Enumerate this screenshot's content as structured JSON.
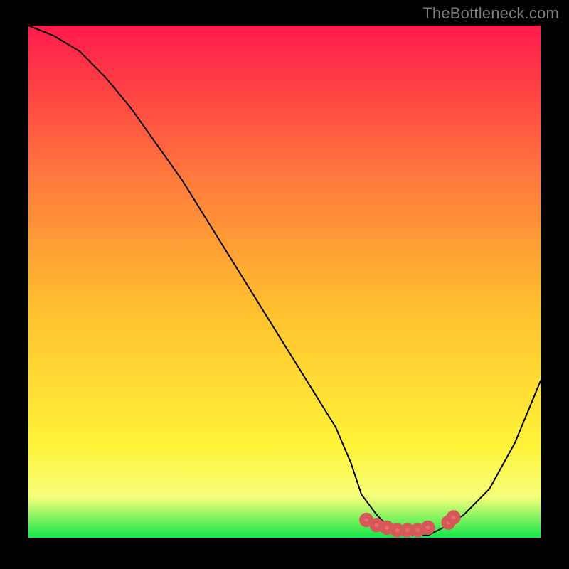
{
  "watermark": "TheBottleneck.com",
  "colors": {
    "frame": "#000000",
    "gradient_top": "#ff1a4b",
    "gradient_upper_mid": "#ff7a3c",
    "gradient_mid": "#ffbf2f",
    "gradient_lower_mid": "#fff338",
    "gradient_low": "#f7ff7a",
    "gradient_bottom": "#14e648",
    "curve": "#000000",
    "dots": "#e46c6c"
  },
  "chart_data": {
    "type": "line",
    "title": "",
    "xlabel": "",
    "ylabel": "",
    "xlim": [
      0,
      100
    ],
    "ylim": [
      0,
      100
    ],
    "series": [
      {
        "name": "bottleneck-curve",
        "x": [
          0,
          5,
          10,
          15,
          20,
          25,
          30,
          35,
          40,
          45,
          50,
          55,
          60,
          63,
          65,
          68,
          70,
          72,
          75,
          78,
          80,
          82,
          85,
          90,
          95,
          100
        ],
        "y": [
          100,
          98,
          95,
          90,
          84,
          77,
          70,
          62,
          54,
          46,
          38,
          30,
          22,
          15,
          9,
          5,
          3,
          2,
          1,
          1,
          2,
          3,
          5,
          10,
          19,
          31
        ]
      }
    ],
    "optimal_markers": {
      "name": "optimal-range-dots",
      "x": [
        66,
        68,
        70,
        72,
        74,
        76,
        78,
        82,
        83
      ],
      "y": [
        4,
        3,
        2.5,
        2,
        2,
        2,
        2.5,
        3.5,
        4.5
      ]
    },
    "background_gradient_stops": [
      {
        "pct": 0,
        "color_key": "gradient_top"
      },
      {
        "pct": 30,
        "color_key": "gradient_upper_mid"
      },
      {
        "pct": 55,
        "color_key": "gradient_mid"
      },
      {
        "pct": 82,
        "color_key": "gradient_lower_mid"
      },
      {
        "pct": 92,
        "color_key": "gradient_low"
      },
      {
        "pct": 100,
        "color_key": "gradient_bottom"
      }
    ]
  }
}
